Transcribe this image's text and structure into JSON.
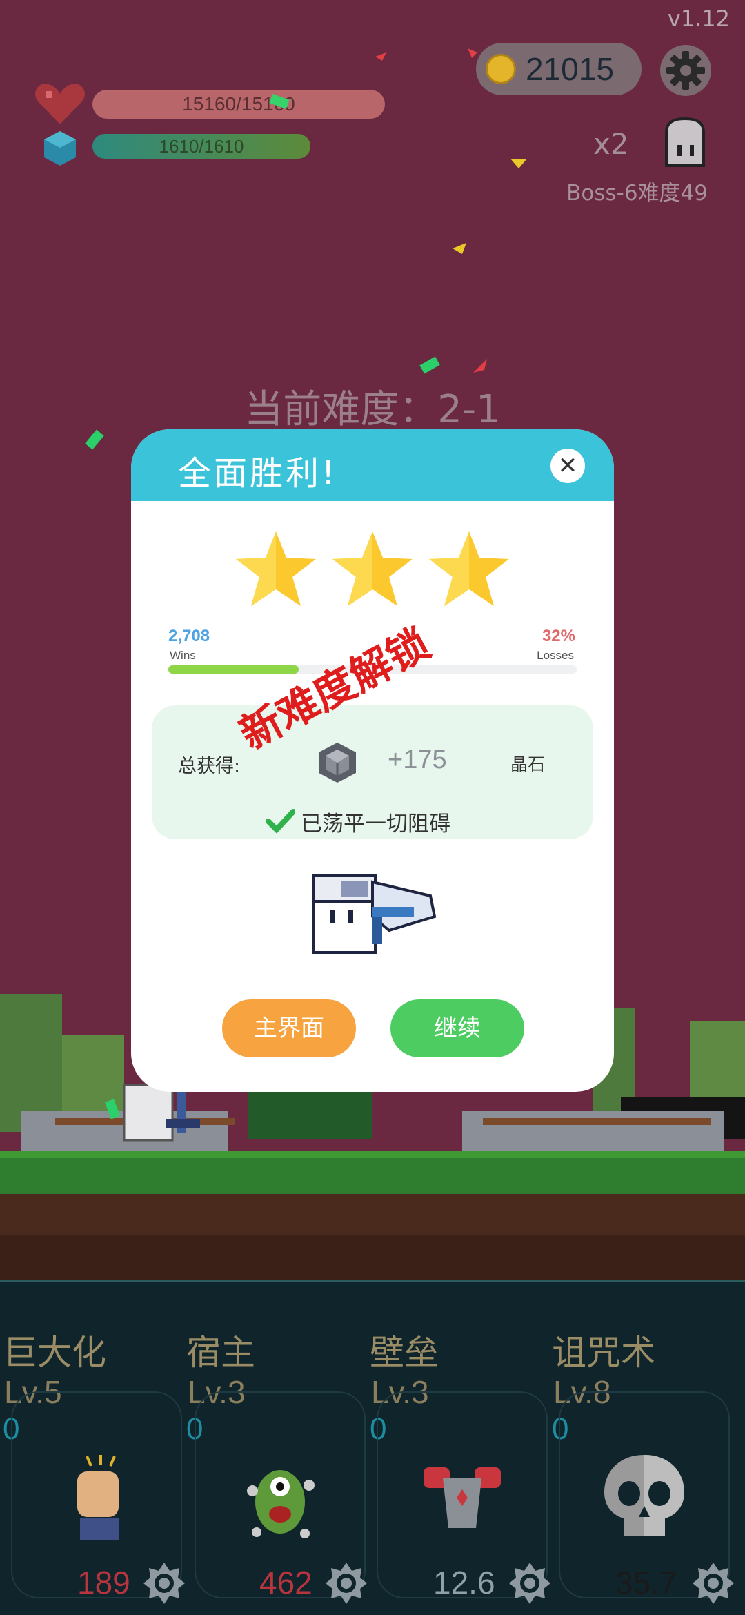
{
  "version": "v1.12",
  "coins": "21015",
  "hp": {
    "text": "15160/15160",
    "fill": 1.0
  },
  "mp": {
    "text": "1610/1610",
    "fill": 1.0
  },
  "multiplier": "x2",
  "boss_label": "Boss-6难度49",
  "current_difficulty": "当前难度：2-1",
  "dialog": {
    "title": "全面胜利!",
    "close_icon": "close-icon",
    "stars": 3,
    "wins_value": "2,708",
    "wins_label": "Wins",
    "losses_value": "32%",
    "losses_label": "Losses",
    "win_progress": 0.32,
    "stamp_text": "新难度解锁",
    "reward_label": "总获得:",
    "reward_value": "+175",
    "reward_unit": "晶石",
    "cleared_text": "已荡平一切阻碍",
    "home_button": "主界面",
    "continue_button": "继续"
  },
  "skills": [
    {
      "name": "巨大化",
      "level": "Lv.5",
      "count": "0",
      "value": "189",
      "value_color": "#b8343f",
      "icon": "fist-icon"
    },
    {
      "name": "宿主",
      "level": "Lv.3",
      "count": "0",
      "value": "462",
      "value_color": "#b8343f",
      "icon": "green-monster-icon"
    },
    {
      "name": "壁垒",
      "level": "Lv.3",
      "count": "0",
      "value": "12.6",
      "value_color": "#8fa0a6",
      "icon": "armor-icon"
    },
    {
      "name": "诅咒术",
      "level": "Lv.8",
      "count": "0",
      "value": "35.7",
      "value_color": "#1a1a1a",
      "icon": "skull-icon"
    }
  ],
  "colors": {
    "accent_header": "#3bc3d9",
    "home": "#f7a440",
    "continue": "#4ccc61",
    "stamp": "#e01d1d"
  }
}
